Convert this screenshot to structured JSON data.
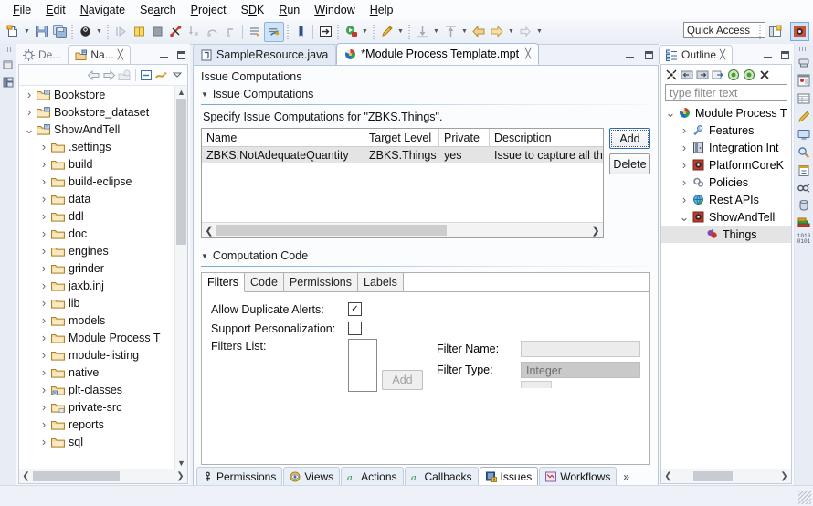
{
  "menu": {
    "items": [
      "File",
      "Edit",
      "Navigate",
      "Search",
      "Project",
      "SDK",
      "Run",
      "Window",
      "Help"
    ]
  },
  "toolbar": {
    "quick_access_placeholder": "Quick Access",
    "icons": [
      "new-wizard-icon",
      "new-dropdown-arrow",
      "save-icon",
      "save-all-icon",
      "debug-icon",
      "debug-dropdown-arrow",
      "run-step-icon",
      "pause-icon",
      "stop-icon",
      "disconnect-icon",
      "step-return-icon",
      "step-over-icon",
      "step-into-icon",
      "skip-breakpoints-icon",
      "toggle-marker-icon",
      "external-tools-icon",
      "open-type-icon",
      "open-type-dropdown-arrow",
      "run-as-icon",
      "run-as-dropdown-arrow",
      "annotate-icon",
      "annotate-dropdown-arrow",
      "next-annotation-icon",
      "next-annotation-arrow",
      "previous-annotation-icon",
      "previous-annotation-arrow",
      "back-icon",
      "forward-icon",
      "forward-dropdown-arrow",
      "next-edit-icon",
      "next-edit-arrow"
    ],
    "perspective_buttons": [
      "open-perspective-icon",
      "java-perspective-icon"
    ]
  },
  "navigator": {
    "tabs": [
      {
        "label": "De...",
        "icon": "debug-view-icon",
        "active": false
      },
      {
        "label": "Na...",
        "icon": "navigator-view-icon",
        "active": true
      }
    ],
    "toolbar_icons": [
      "back-arrow-icon",
      "forward-arrow-icon",
      "home-icon",
      "collapse-all-icon",
      "link-editor-icon",
      "view-menu-icon"
    ],
    "items": [
      {
        "label": "Bookstore",
        "depth": 0,
        "twist": "collapsed",
        "icon": "folder-project-icon"
      },
      {
        "label": "Bookstore_dataset",
        "depth": 0,
        "twist": "collapsed",
        "icon": "folder-project-icon"
      },
      {
        "label": "ShowAndTell",
        "depth": 0,
        "twist": "expanded",
        "icon": "folder-project-icon"
      },
      {
        "label": ".settings",
        "depth": 1,
        "twist": "collapsed",
        "icon": "folder-icon"
      },
      {
        "label": "build",
        "depth": 1,
        "twist": "collapsed",
        "icon": "folder-icon"
      },
      {
        "label": "build-eclipse",
        "depth": 1,
        "twist": "collapsed",
        "icon": "folder-icon"
      },
      {
        "label": "data",
        "depth": 1,
        "twist": "collapsed",
        "icon": "folder-icon"
      },
      {
        "label": "ddl",
        "depth": 1,
        "twist": "collapsed",
        "icon": "folder-icon"
      },
      {
        "label": "doc",
        "depth": 1,
        "twist": "collapsed",
        "icon": "folder-icon"
      },
      {
        "label": "engines",
        "depth": 1,
        "twist": "collapsed",
        "icon": "folder-icon"
      },
      {
        "label": "grinder",
        "depth": 1,
        "twist": "collapsed",
        "icon": "folder-icon"
      },
      {
        "label": "jaxb.inj",
        "depth": 1,
        "twist": "collapsed",
        "icon": "folder-icon"
      },
      {
        "label": "lib",
        "depth": 1,
        "twist": "collapsed",
        "icon": "folder-icon"
      },
      {
        "label": "models",
        "depth": 1,
        "twist": "collapsed",
        "icon": "folder-icon"
      },
      {
        "label": "Module Process T",
        "depth": 1,
        "twist": "collapsed",
        "icon": "folder-icon"
      },
      {
        "label": "module-listing",
        "depth": 1,
        "twist": "collapsed",
        "icon": "folder-icon"
      },
      {
        "label": "native",
        "depth": 1,
        "twist": "collapsed",
        "icon": "folder-icon"
      },
      {
        "label": "plt-classes",
        "depth": 1,
        "twist": "collapsed",
        "icon": "folder-linked-icon"
      },
      {
        "label": "private-src",
        "depth": 1,
        "twist": "collapsed",
        "icon": "folder-source-icon"
      },
      {
        "label": "reports",
        "depth": 1,
        "twist": "collapsed",
        "icon": "folder-icon"
      },
      {
        "label": "sql",
        "depth": 1,
        "twist": "collapsed",
        "icon": "folder-icon"
      }
    ]
  },
  "editor": {
    "tabs": [
      {
        "label": "SampleResource.java",
        "icon": "java-file-icon",
        "active": false,
        "dirty": false
      },
      {
        "label": "*Module Process Template.mpt",
        "icon": "mpt-file-icon",
        "active": true,
        "dirty": true
      }
    ],
    "form_header": "Issue Computations",
    "sections": {
      "issue_computations": {
        "title": "Issue Computations",
        "description": "Specify Issue Computations for \"ZBKS.Things\".",
        "table": {
          "columns": [
            "Name",
            "Target Level",
            "Private",
            "Description"
          ],
          "rows": [
            [
              "ZBKS.NotAdequateQuantity",
              "ZBKS.Things",
              "yes",
              "Issue to capture all the"
            ]
          ]
        },
        "buttons": [
          "Add",
          "Delete"
        ]
      },
      "computation_code": {
        "title": "Computation Code",
        "tabs": [
          "Filters",
          "Code",
          "Permissions",
          "Labels"
        ],
        "active_tab": "Filters",
        "fields": {
          "allow_duplicate_alerts_label": "Allow Duplicate Alerts:",
          "allow_duplicate_alerts_checked": true,
          "support_personalization_label": "Support Personalization:",
          "support_personalization_checked": false,
          "filters_list_label": "Filters List:",
          "add_button": "Add",
          "filter_name_label": "Filter Name:",
          "filter_name_value": "",
          "filter_type_label": "Filter Type:",
          "filter_type_value": "Integer"
        }
      }
    },
    "bottom_tabs": [
      {
        "label": "Permissions",
        "icon": "permissions-icon",
        "active": false
      },
      {
        "label": "Views",
        "icon": "views-icon",
        "active": false
      },
      {
        "label": "Actions",
        "icon": "actions-icon",
        "active": false
      },
      {
        "label": "Callbacks",
        "icon": "callbacks-icon",
        "active": false
      },
      {
        "label": "Issues",
        "icon": "issues-icon",
        "active": true
      },
      {
        "label": "Workflows",
        "icon": "workflows-icon",
        "active": false
      },
      {
        "label": "»",
        "icon": "more-tabs-icon",
        "active": false
      }
    ]
  },
  "outline": {
    "tab_label": "Outline",
    "tab_icon": "outline-view-icon",
    "toolbar_icons": [
      "collapse-all-icon",
      "hide-left-icon",
      "hide-right-icon",
      "export-icon",
      "filter-one-icon",
      "filter-two-icon",
      "sort-icon"
    ],
    "filter_placeholder": "type filter text",
    "items": [
      {
        "label": "Module Process T",
        "depth": 0,
        "twist": "expanded",
        "icon": "mpt-root-icon",
        "selected": false
      },
      {
        "label": "Features",
        "depth": 1,
        "twist": "collapsed",
        "icon": "features-icon",
        "selected": false
      },
      {
        "label": "Integration Int",
        "depth": 1,
        "twist": "collapsed",
        "icon": "integration-icon",
        "selected": false
      },
      {
        "label": "PlatformCoreK",
        "depth": 1,
        "twist": "collapsed",
        "icon": "module-icon",
        "selected": false
      },
      {
        "label": "Policies",
        "depth": 1,
        "twist": "collapsed",
        "icon": "policies-icon",
        "selected": false
      },
      {
        "label": "Rest APIs",
        "depth": 1,
        "twist": "collapsed",
        "icon": "rest-apis-icon",
        "selected": false
      },
      {
        "label": "ShowAndTell",
        "depth": 1,
        "twist": "expanded",
        "icon": "module-icon",
        "selected": false
      },
      {
        "label": "Things",
        "depth": 2,
        "twist": "none",
        "icon": "things-icon",
        "selected": true
      }
    ]
  },
  "right_bar": {
    "icons": [
      "servers-icon",
      "database-explorer-icon",
      "properties-icon",
      "annotate-icon",
      "console-icon",
      "search-icon",
      "tasks-icon",
      "bindings-icon",
      "data-source-icon",
      "library-icon",
      "binary-icon"
    ]
  },
  "colors": {
    "accent": "#2b6cb8",
    "chrome": "#eef1f8",
    "tab_active": "#fbfcfe",
    "selection": "#e4e4e4",
    "field_disabled": "#c9c9c9"
  }
}
